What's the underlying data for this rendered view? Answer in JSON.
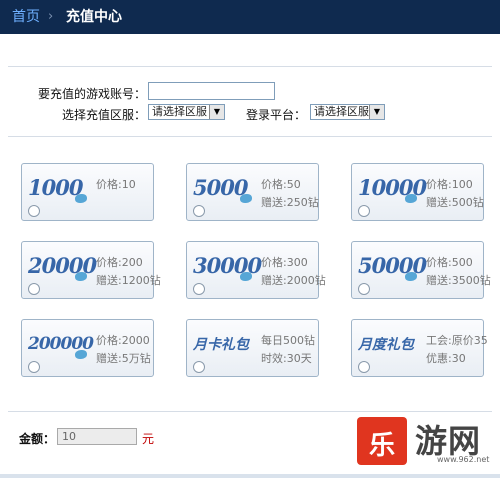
{
  "breadcrumb": {
    "home": "首页",
    "separator": "›",
    "current": "充值中心"
  },
  "form": {
    "account_label": "要充值的游戏账号：",
    "account_value": "",
    "server_label": "选择充值区服：",
    "server_select": "请选择区服",
    "platform_label": "登录平台：",
    "platform_select": "请选择区服"
  },
  "cards": [
    {
      "amount": "1000",
      "line1": "价格:10",
      "line2": ""
    },
    {
      "amount": "5000",
      "line1": "价格:50",
      "line2": "赠送:250钻"
    },
    {
      "amount": "10000",
      "line1": "价格:100",
      "line2": "赠送:500钻"
    },
    {
      "amount": "20000",
      "line1": "价格:200",
      "line2": "赠送:1200钻"
    },
    {
      "amount": "30000",
      "line1": "价格:300",
      "line2": "赠送:2000钻"
    },
    {
      "amount": "50000",
      "line1": "价格:500",
      "line2": "赠送:3500钻"
    },
    {
      "amount": "200000",
      "line1": "价格:2000",
      "line2": "赠送:5万钻"
    },
    {
      "amount": "月卡礼包",
      "line1": "每日500钻",
      "line2": "时效:30天"
    },
    {
      "amount": "月度礼包",
      "line1": "工会:原价35",
      "line2": "优惠:30"
    }
  ],
  "amount": {
    "label": "金额：",
    "value": "10",
    "unit": "元"
  },
  "watermark": {
    "glyph": "乐",
    "text": "游网",
    "url": "www.962.net"
  }
}
